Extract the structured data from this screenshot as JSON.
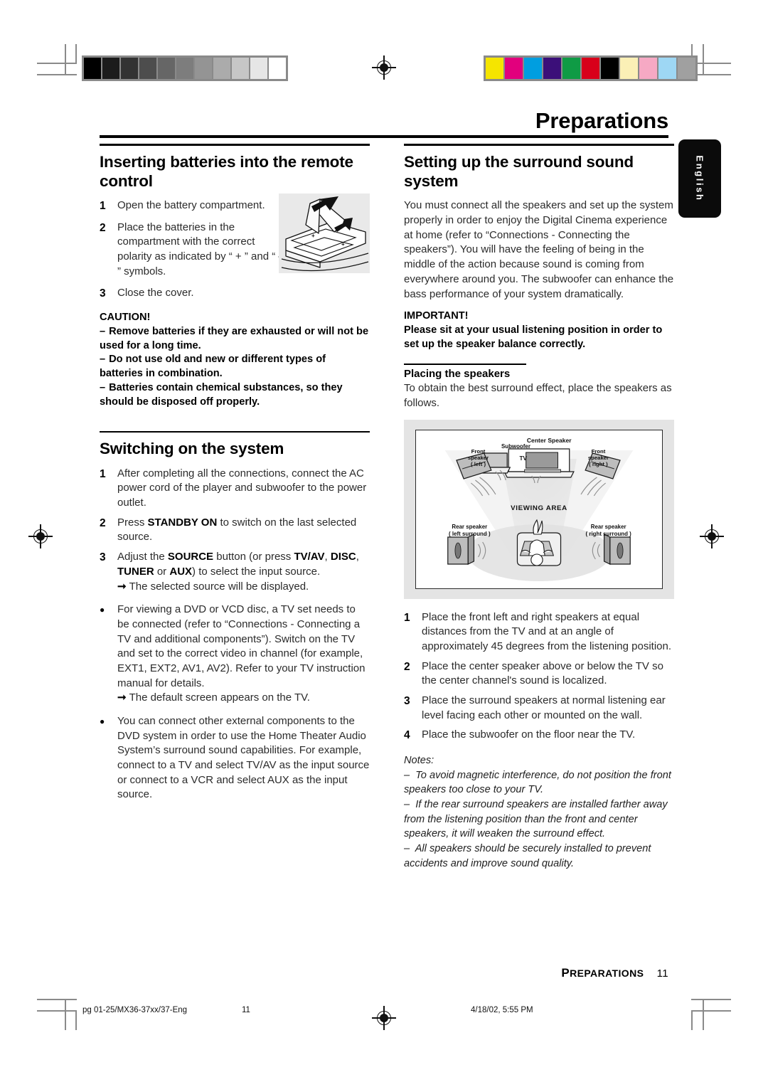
{
  "chapter": {
    "title": "Preparations",
    "language_tab": "English"
  },
  "left_column": {
    "section1": {
      "heading": "Inserting batteries into the remote control",
      "steps": [
        {
          "marker": "1",
          "text": "Open the battery compartment."
        },
        {
          "marker": "2",
          "text": "Place the batteries in the compartment with the correct polarity as indicated by “ + ” and “ — ” symbols."
        },
        {
          "marker": "3",
          "text": "Close the cover."
        }
      ],
      "caution": {
        "heading": "CAUTION!",
        "items": [
          "Remove batteries if they are exhausted or will not be used for a long time.",
          "Do not use old and new or different types of batteries in combination.",
          "Batteries contain chemical substances, so they should be disposed off properly."
        ]
      },
      "figure_name": "remote-battery-compartment-illustration"
    },
    "section2": {
      "heading": "Switching on the system",
      "steps": [
        {
          "marker": "1",
          "text": "After completing all the connections, connect the AC power cord of the player and subwoofer to the power outlet."
        },
        {
          "marker": "2",
          "text": "Press STANDBY ON to switch on the last selected source.",
          "bold_parts": [
            "STANDBY ON"
          ]
        },
        {
          "marker": "3",
          "text": "Adjust the SOURCE button (or press TV/AV, DISC, TUNER or AUX) to select the input source.",
          "result": "The selected source will be displayed."
        },
        {
          "marker": "●",
          "text": "For viewing a DVD or VCD disc, a TV set needs to be connected (refer to “Connections - Connecting a TV and additional components”). Switch on the TV and set to the correct video in channel (for example, EXT1, EXT2, AV1, AV2). Refer to your TV instruction manual for details.",
          "result": "The default screen appears on the TV."
        },
        {
          "marker": "●",
          "text": "You can connect other external components to the DVD system in order to use the Home Theater Audio System’s surround sound capabilities. For example, connect to a TV and select TV/AV as the input source or connect to a VCR and select AUX as the input source."
        }
      ]
    }
  },
  "right_column": {
    "section1": {
      "heading": "Setting up the surround sound system",
      "body": "You must connect all the speakers and set up the system properly in order to enjoy the Digital Cinema experience at home (refer to “Connections - Connecting the speakers”). You will have the feeling of being in the middle of the action because sound is coming from everywhere around you. The subwoofer can enhance the bass performance of your system dramatically.",
      "important": {
        "heading": "IMPORTANT!",
        "text": "Please sit at your usual listening position in order to set up the speaker balance correctly."
      },
      "subheading": "Placing the speakers",
      "intro": "To obtain the best surround effect, place the speakers as follows.",
      "diagram": {
        "name": "speaker-placement-diagram",
        "labels": {
          "front_left": "Front\nspeaker\n( left )",
          "subwoofer": "Subwoofer",
          "center": "Center Speaker",
          "tv": "TV",
          "front_right": "Front\nspeaker\n( right )",
          "viewing_area": "VIEWING AREA",
          "rear_left": "Rear speaker\n( left surround )",
          "rear_right": "Rear speaker\n( right surround )"
        }
      },
      "steps": [
        {
          "marker": "1",
          "text": "Place the front left and right speakers at equal distances from the TV and at an angle of approximately 45 degrees from the listening position."
        },
        {
          "marker": "2",
          "text": "Place the center speaker above or below the TV so the center channel's sound is localized."
        },
        {
          "marker": "3",
          "text": "Place the surround speakers at normal listening ear level facing each other or mounted on the wall."
        },
        {
          "marker": "4",
          "text": "Place the subwoofer on the floor near the TV."
        }
      ],
      "notes": {
        "heading": "Notes:",
        "items": [
          "To avoid magnetic interference, do not position the front speakers too close to your TV.",
          "If the rear surround speakers are installed farther away from the listening position than the front and center speakers, it will weaken the surround effect.",
          "All speakers should be securely installed to prevent accidents and improve sound quality."
        ]
      }
    }
  },
  "footer": {
    "chapter_small_caps": "PREPARATIONS",
    "page_number": "11"
  },
  "print_line": {
    "file": "pg 01-25/MX36-37xx/37-Eng",
    "page": "11",
    "date": "4/18/02, 5:55 PM"
  },
  "calibration": {
    "grayscale_swatches": [
      "#000000",
      "#1c1c1c",
      "#333333",
      "#4d4d4d",
      "#666666",
      "#7d7d7d",
      "#949494",
      "#ababab",
      "#c6c6c6",
      "#e6e6e6",
      "#ffffff"
    ],
    "color_swatches": [
      "#f5e500",
      "#e2007d",
      "#009ee0",
      "#3b0f79",
      "#0f9b45",
      "#d8001a",
      "#000000",
      "#fbf0b6",
      "#f6a9c4",
      "#9ed7f4",
      "#a0a0a0"
    ]
  }
}
